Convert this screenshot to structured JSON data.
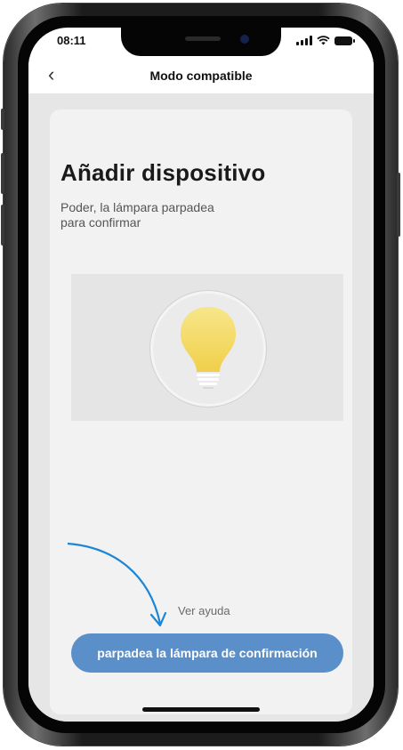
{
  "status_bar": {
    "time": "08:11"
  },
  "nav": {
    "back_icon": "chevron-left-icon",
    "title": "Modo compatible"
  },
  "main": {
    "title": "Añadir dispositivo",
    "subtitle": "Poder, la lámpara parpadea\npara confirmar",
    "illustration_icon": "lightbulb-icon",
    "help_link": "Ver ayuda",
    "primary_button": "parpadea la lámpara de confirmación"
  },
  "colors": {
    "accent": "#5a8fca",
    "arrow": "#1b86d6",
    "bulb": "#f6df6e",
    "card": "#f2f2f2"
  }
}
